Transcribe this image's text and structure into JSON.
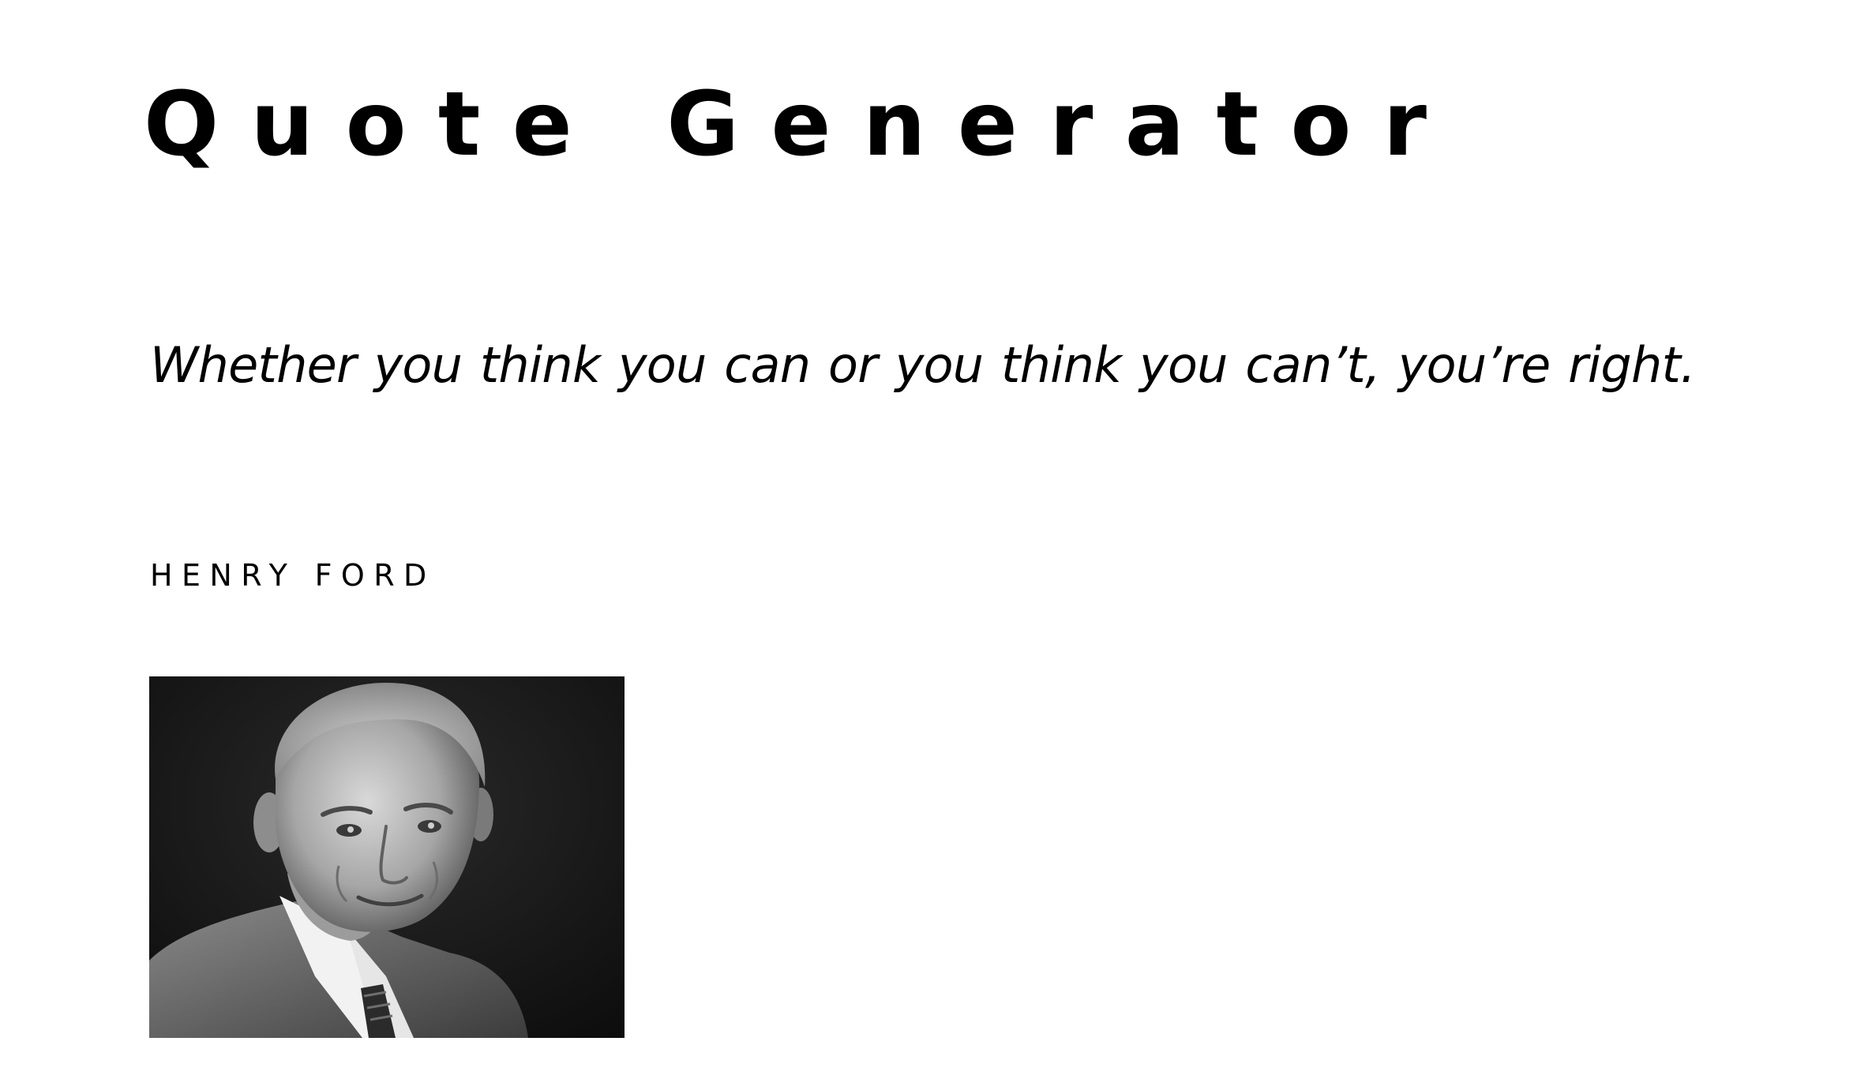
{
  "header": {
    "title": "Quote Generator"
  },
  "quote": {
    "text": "Whether you think you can or you think you can’t, you’re right.",
    "author": "HENRY FORD"
  },
  "author_image": {
    "subject": "Henry Ford portrait",
    "style": "black-and-white photograph"
  }
}
